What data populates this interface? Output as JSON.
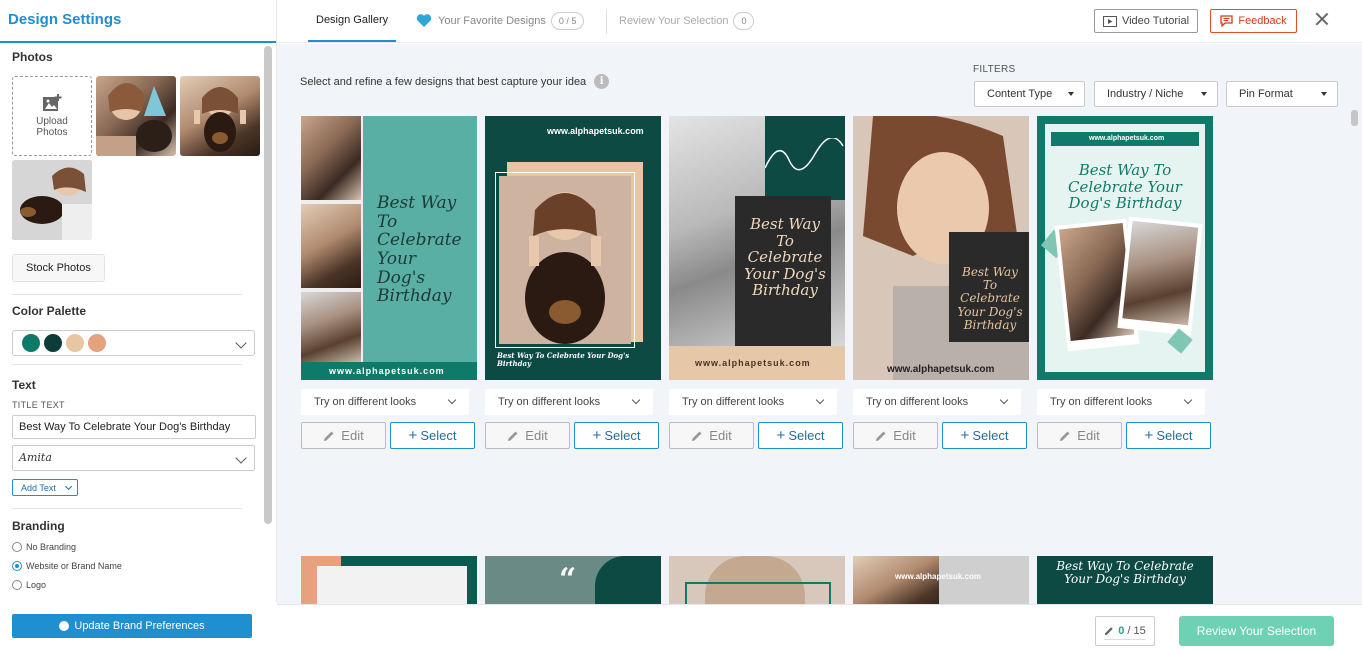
{
  "sidebar": {
    "title": "Design Settings",
    "photos": {
      "heading": "Photos",
      "upload_label_1": "Upload",
      "upload_label_2": "Photos",
      "stock_label": "Stock Photos"
    },
    "palette": {
      "heading": "Color Palette",
      "colors": [
        "#0f7a6a",
        "#0c3d3a",
        "#e8c6a2",
        "#e6a27e"
      ]
    },
    "text": {
      "heading": "Text",
      "title_label": "TITLE TEXT",
      "title_value": "Best Way To Celebrate Your Dog's Birthday",
      "font_value": "Amita",
      "add_text_label": "Add Text"
    },
    "branding": {
      "heading": "Branding",
      "options": [
        "No Branding",
        "Website or Brand Name",
        "Logo"
      ],
      "selected": "Website or Brand Name"
    },
    "update_label": "Update Brand Preferences"
  },
  "topbar": {
    "tab_gallery": "Design Gallery",
    "tab_favorites": "Your Favorite Designs",
    "favorites_count": "0 / 5",
    "tab_review": "Review Your Selection",
    "review_count": "0",
    "video_label": "Video Tutorial",
    "feedback_label": "Feedback"
  },
  "main": {
    "intro": "Select and refine a few designs that best capture your idea",
    "filters_label": "FILTERS",
    "filters": [
      "Content Type",
      "Industry / Niche",
      "Pin Format"
    ],
    "cards": [
      {
        "headline": "Best Way To Celebrate Your Dog's Birthday",
        "url": "www.alphapetsuk.com",
        "look": "Try on different looks",
        "edit": "Edit",
        "select": "Select"
      },
      {
        "headline": "Best Way To Celebrate Your Dog's Birthday",
        "url": "www.alphapetsuk.com",
        "look": "Try on different looks",
        "edit": "Edit",
        "select": "Select"
      },
      {
        "headline": "Best Way To Celebrate Your Dog's Birthday",
        "url": "www.alphapetsuk.com",
        "look": "Try on different looks",
        "edit": "Edit",
        "select": "Select"
      },
      {
        "headline": "Best Way To Celebrate Your Dog's Birthday",
        "url": "www.alphapetsuk.com",
        "look": "Try on different looks",
        "edit": "Edit",
        "select": "Select"
      },
      {
        "headline": "Best Way To Celebrate Your Dog's Birthday",
        "url": "www.alphapetsuk.com",
        "look": "Try on different looks",
        "edit": "Edit",
        "select": "Select"
      }
    ],
    "row2_url": "www.alphapetsuk.com",
    "row2_headline": "Best Way To Celebrate Your Dog's Birthday"
  },
  "bottombar": {
    "count_used": "0",
    "count_total": "/ 15",
    "review_label": "Review Your Selection"
  }
}
